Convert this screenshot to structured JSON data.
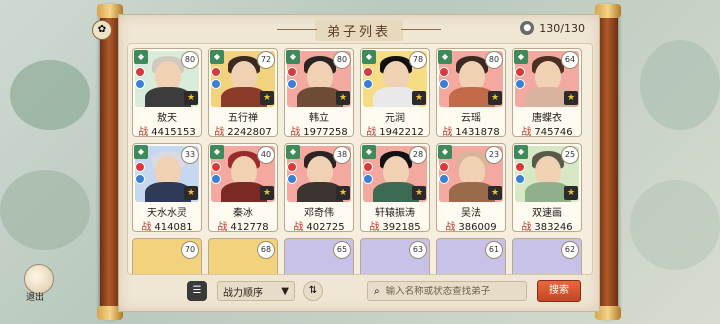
{
  "title": "弟子列表",
  "capacity": "130/130",
  "colors": {
    "accent": "#c24622",
    "power_label": "#c0392b"
  },
  "disciples": [
    {
      "name": "敖天",
      "power_label": "战",
      "power": "4415153",
      "level": "80",
      "bg": "#d9ecd9",
      "hair": "#cfc9c0",
      "body": "#3c3c3c"
    },
    {
      "name": "五行禅",
      "power_label": "战",
      "power": "2242807",
      "level": "72",
      "bg": "#f3d27d",
      "hair": "#3a2a22",
      "body": "#8a3b2a"
    },
    {
      "name": "韩立",
      "power_label": "战",
      "power": "1977258",
      "level": "80",
      "bg": "#f3a8a0",
      "hair": "#2b2422",
      "body": "#6e4b35"
    },
    {
      "name": "元润",
      "power_label": "战",
      "power": "1942212",
      "level": "78",
      "bg": "#f6dd84",
      "hair": "#111111",
      "body": "#e9e9e9"
    },
    {
      "name": "云瑶",
      "power_label": "战",
      "power": "1431878",
      "level": "80",
      "bg": "#f3a8a0",
      "hair": "#3a2a22",
      "body": "#c26a4a"
    },
    {
      "name": "唐蝶衣",
      "power_label": "战",
      "power": "745746",
      "level": "64",
      "bg": "#f3a8a0",
      "hair": "#4a2f22",
      "body": "#d8b4a0"
    },
    {
      "name": "天水水灵",
      "power_label": "战",
      "power": "414081",
      "level": "33",
      "bg": "#c6d8ef",
      "hair": "#d8dbe4",
      "body": "#2f3a56"
    },
    {
      "name": "秦冰",
      "power_label": "战",
      "power": "412778",
      "level": "40",
      "bg": "#f3a8a0",
      "hair": "#9b2b2a",
      "body": "#7a2a22"
    },
    {
      "name": "邓奇伟",
      "power_label": "战",
      "power": "402725",
      "level": "38",
      "bg": "#f3a8a0",
      "hair": "#2b2422",
      "body": "#3c3430"
    },
    {
      "name": "轩辕振涛",
      "power_label": "战",
      "power": "392185",
      "level": "28",
      "bg": "#f3a8a0",
      "hair": "#111111",
      "body": "#3c6a52"
    },
    {
      "name": "吴法",
      "power_label": "战",
      "power": "386009",
      "level": "23",
      "bg": "#f3a8a0",
      "hair": "#d9b49a",
      "body": "#9a6b4a"
    },
    {
      "name": "双速画",
      "power_label": "战",
      "power": "383246",
      "level": "25",
      "bg": "#d6e8c6",
      "hair": "#5a5a4a",
      "body": "#8fb08a"
    }
  ],
  "partial_row_levels": [
    "70",
    "68",
    "65",
    "63",
    "61",
    "62"
  ],
  "toolbar": {
    "exit_label": "退出",
    "sort_label": "战力顺序",
    "search_placeholder": "输入名称或状态查找弟子",
    "search_button": "搜索"
  },
  "icons": {
    "sort_arrow": "▼",
    "swap": "⇅",
    "search": "🔍",
    "list": "☰",
    "star": "★",
    "capacity": "person-icon"
  }
}
